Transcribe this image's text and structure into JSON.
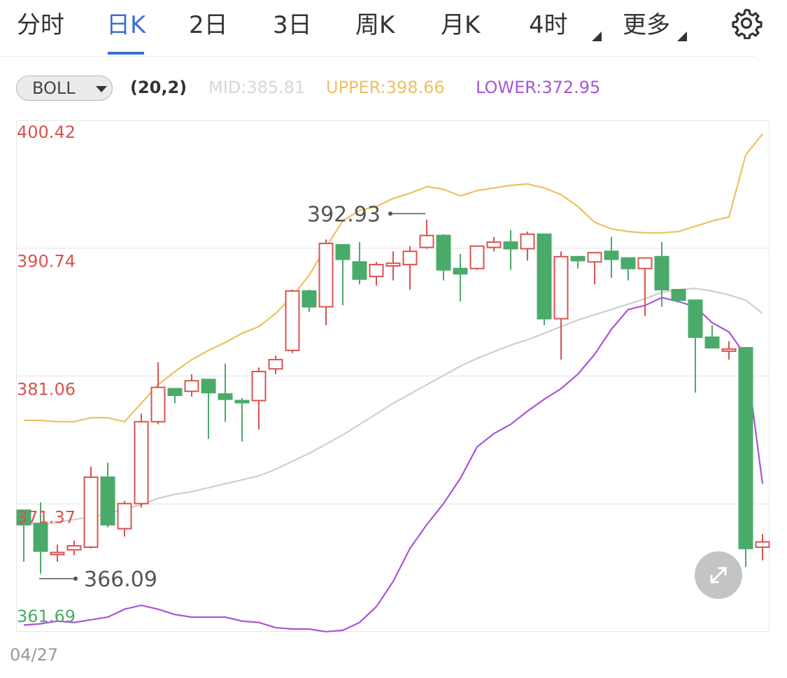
{
  "tabs": [
    {
      "label": "分时"
    },
    {
      "label": "日K"
    },
    {
      "label": "2日"
    },
    {
      "label": "3日"
    },
    {
      "label": "周K"
    },
    {
      "label": "月K"
    },
    {
      "label": "4时"
    },
    {
      "label": "更多"
    }
  ],
  "active_tab": "日K",
  "indicator": {
    "name": "BOLL",
    "params": "(20,2)",
    "mid_text": "MID:385.81",
    "upper_text": "UPPER:398.66",
    "lower_text": "LOWER:372.95"
  },
  "colors": {
    "up": "#d9534f",
    "down": "#4aaa6a",
    "mid_line": "#cfcfcf",
    "upper_line": "#ecc160",
    "lower_line": "#a855d8",
    "mid_text": "#d6d6d6",
    "accent": "#3b6fd6"
  },
  "icons": {
    "settings": "gear-icon",
    "expand": "expand-icon",
    "dropdown": "caret-down-icon"
  },
  "date_label": "04/27",
  "chart_data": {
    "type": "candlestick",
    "y_ticks": [
      400.42,
      390.74,
      381.06,
      371.37,
      361.69
    ],
    "y_tick_labels": [
      "400.42",
      "390.74",
      "381.06",
      "371.37",
      "361.69"
    ],
    "ylim": [
      361.69,
      400.42
    ],
    "grid": true,
    "annotations": [
      {
        "label": "392.93",
        "value": 392.93,
        "type": "max"
      },
      {
        "label": "366.09",
        "value": 366.09,
        "type": "min"
      }
    ],
    "candles": [
      {
        "o": 369.8,
        "c": 370.9,
        "h": 370.9,
        "l": 367.0,
        "dir": "down"
      },
      {
        "o": 369.9,
        "c": 367.8,
        "h": 371.5,
        "l": 366.1,
        "dir": "down"
      },
      {
        "o": 367.6,
        "c": 367.7,
        "h": 368.3,
        "l": 367.0,
        "dir": "up"
      },
      {
        "o": 367.9,
        "c": 368.2,
        "h": 368.6,
        "l": 367.5,
        "dir": "up"
      },
      {
        "o": 368.1,
        "c": 373.4,
        "h": 374.2,
        "l": 368.0,
        "dir": "up"
      },
      {
        "o": 373.4,
        "c": 369.8,
        "h": 374.5,
        "l": 369.6,
        "dir": "down"
      },
      {
        "o": 369.5,
        "c": 371.4,
        "h": 371.6,
        "l": 368.9,
        "dir": "up"
      },
      {
        "o": 371.4,
        "c": 377.6,
        "h": 378.2,
        "l": 371.1,
        "dir": "up"
      },
      {
        "o": 377.6,
        "c": 380.2,
        "h": 382.1,
        "l": 377.4,
        "dir": "up"
      },
      {
        "o": 380.1,
        "c": 379.6,
        "h": 380.1,
        "l": 379.0,
        "dir": "down"
      },
      {
        "o": 379.9,
        "c": 380.7,
        "h": 381.2,
        "l": 379.5,
        "dir": "up"
      },
      {
        "o": 380.8,
        "c": 379.8,
        "h": 380.8,
        "l": 376.3,
        "dir": "down"
      },
      {
        "o": 379.7,
        "c": 379.3,
        "h": 382.0,
        "l": 377.6,
        "dir": "down"
      },
      {
        "o": 379.2,
        "c": 379.1,
        "h": 379.4,
        "l": 376.1,
        "dir": "down"
      },
      {
        "o": 379.2,
        "c": 381.4,
        "h": 381.7,
        "l": 377.0,
        "dir": "up"
      },
      {
        "o": 381.6,
        "c": 382.3,
        "h": 382.6,
        "l": 381.2,
        "dir": "up"
      },
      {
        "o": 383.0,
        "c": 387.5,
        "h": 387.6,
        "l": 382.8,
        "dir": "up"
      },
      {
        "o": 387.5,
        "c": 386.3,
        "h": 387.6,
        "l": 385.9,
        "dir": "down"
      },
      {
        "o": 386.3,
        "c": 391.1,
        "h": 391.4,
        "l": 384.9,
        "dir": "up"
      },
      {
        "o": 391.0,
        "c": 389.9,
        "h": 391.0,
        "l": 386.4,
        "dir": "down"
      },
      {
        "o": 389.7,
        "c": 388.4,
        "h": 391.2,
        "l": 388.0,
        "dir": "down"
      },
      {
        "o": 388.6,
        "c": 389.5,
        "h": 389.7,
        "l": 387.9,
        "dir": "up"
      },
      {
        "o": 389.4,
        "c": 389.6,
        "h": 390.5,
        "l": 388.3,
        "dir": "up"
      },
      {
        "o": 389.5,
        "c": 390.5,
        "h": 390.9,
        "l": 387.6,
        "dir": "up"
      },
      {
        "o": 390.8,
        "c": 391.7,
        "h": 392.9,
        "l": 390.7,
        "dir": "up"
      },
      {
        "o": 391.7,
        "c": 389.1,
        "h": 391.8,
        "l": 388.3,
        "dir": "down"
      },
      {
        "o": 389.2,
        "c": 388.8,
        "h": 390.3,
        "l": 386.7,
        "dir": "down"
      },
      {
        "o": 389.2,
        "c": 390.9,
        "h": 390.9,
        "l": 389.1,
        "dir": "up"
      },
      {
        "o": 390.8,
        "c": 391.2,
        "h": 391.6,
        "l": 390.5,
        "dir": "up"
      },
      {
        "o": 391.2,
        "c": 390.7,
        "h": 392.1,
        "l": 389.1,
        "dir": "down"
      },
      {
        "o": 390.7,
        "c": 391.8,
        "h": 392.0,
        "l": 389.8,
        "dir": "up"
      },
      {
        "o": 391.8,
        "c": 385.4,
        "h": 391.8,
        "l": 384.9,
        "dir": "down"
      },
      {
        "o": 385.4,
        "c": 390.1,
        "h": 390.5,
        "l": 382.3,
        "dir": "up"
      },
      {
        "o": 390.1,
        "c": 389.8,
        "h": 390.1,
        "l": 389.2,
        "dir": "down"
      },
      {
        "o": 389.7,
        "c": 390.4,
        "h": 390.4,
        "l": 388.0,
        "dir": "up"
      },
      {
        "o": 390.5,
        "c": 389.9,
        "h": 391.6,
        "l": 388.5,
        "dir": "down"
      },
      {
        "o": 390.0,
        "c": 389.2,
        "h": 390.0,
        "l": 388.3,
        "dir": "down"
      },
      {
        "o": 389.2,
        "c": 390.0,
        "h": 390.0,
        "l": 385.6,
        "dir": "up"
      },
      {
        "o": 390.1,
        "c": 387.6,
        "h": 391.2,
        "l": 386.3,
        "dir": "down"
      },
      {
        "o": 387.6,
        "c": 386.8,
        "h": 387.6,
        "l": 386.8,
        "dir": "down"
      },
      {
        "o": 386.8,
        "c": 384.0,
        "h": 386.8,
        "l": 379.8,
        "dir": "down"
      },
      {
        "o": 384.0,
        "c": 383.2,
        "h": 384.9,
        "l": 383.2,
        "dir": "down"
      },
      {
        "o": 383.1,
        "c": 383.0,
        "h": 383.7,
        "l": 382.3,
        "dir": "up"
      },
      {
        "o": 383.2,
        "c": 368.0,
        "h": 383.2,
        "l": 366.6,
        "dir": "down"
      },
      {
        "o": 368.1,
        "c": 368.5,
        "h": 369.1,
        "l": 367.1,
        "dir": "up"
      }
    ],
    "series": [
      {
        "name": "UPPER",
        "values": [
          377.7,
          377.7,
          377.6,
          377.6,
          377.9,
          377.9,
          377.6,
          379.0,
          380.4,
          381.4,
          382.3,
          383.0,
          383.6,
          384.3,
          384.8,
          385.8,
          387.1,
          388.7,
          390.8,
          392.8,
          393.6,
          393.9,
          394.5,
          394.9,
          395.4,
          395.2,
          394.7,
          395.1,
          395.3,
          395.5,
          395.6,
          395.3,
          394.8,
          393.9,
          392.7,
          392.2,
          392.0,
          391.9,
          391.9,
          392.0,
          392.4,
          392.8,
          393.1,
          397.8,
          399.4
        ]
      },
      {
        "name": "MID",
        "values": [
          369.9,
          369.8,
          370.0,
          370.2,
          370.4,
          370.6,
          371.0,
          371.3,
          371.8,
          372.1,
          372.3,
          372.6,
          372.9,
          373.2,
          373.5,
          374.0,
          374.6,
          375.2,
          375.9,
          376.6,
          377.4,
          378.2,
          379.0,
          379.7,
          380.4,
          381.1,
          381.8,
          382.4,
          382.9,
          383.4,
          383.8,
          384.3,
          384.8,
          385.3,
          385.7,
          386.1,
          386.5,
          386.9,
          387.4,
          387.6,
          387.7,
          387.5,
          387.2,
          386.8,
          385.8
        ]
      },
      {
        "name": "LOWER",
        "values": [
          362.2,
          362.3,
          362.5,
          362.4,
          362.6,
          362.8,
          363.4,
          363.7,
          363.4,
          363.0,
          362.8,
          362.8,
          362.8,
          362.5,
          362.4,
          362.0,
          361.9,
          361.9,
          361.7,
          361.8,
          362.4,
          363.6,
          365.5,
          368.0,
          369.8,
          371.4,
          373.3,
          375.7,
          376.7,
          377.4,
          378.4,
          379.3,
          380.1,
          381.2,
          382.7,
          384.6,
          386.1,
          386.4,
          387.0,
          386.7,
          386.3,
          385.1,
          384.4,
          382.6,
          372.9
        ]
      }
    ]
  }
}
